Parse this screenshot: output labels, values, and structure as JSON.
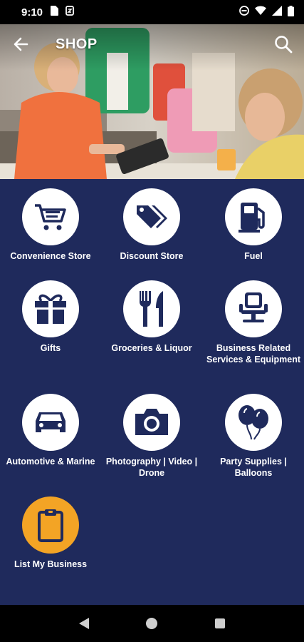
{
  "status": {
    "time": "9:10"
  },
  "header": {
    "title": "SHOP"
  },
  "categories": [
    {
      "label": "Convenience Store",
      "icon": "shopping-cart-icon"
    },
    {
      "label": "Discount Store",
      "icon": "price-tag-icon"
    },
    {
      "label": "Fuel",
      "icon": "fuel-pump-icon"
    },
    {
      "label": "Gifts",
      "icon": "gift-icon"
    },
    {
      "label": "Groceries & Liquor",
      "icon": "fork-knife-icon"
    },
    {
      "label": "Business Related Services & Equipment",
      "icon": "office-chair-icon"
    },
    {
      "label": "Automotive & Marine",
      "icon": "car-icon"
    },
    {
      "label": "Photography | Video | Drone",
      "icon": "camera-icon"
    },
    {
      "label": "Party Supplies | Balloons",
      "icon": "balloons-icon"
    }
  ],
  "list_business": {
    "label": "List My Business",
    "icon": "clipboard-icon"
  },
  "colors": {
    "background": "#1f2a5c",
    "accent": "#f3a425",
    "icon_fill": "#1f2a5c"
  }
}
